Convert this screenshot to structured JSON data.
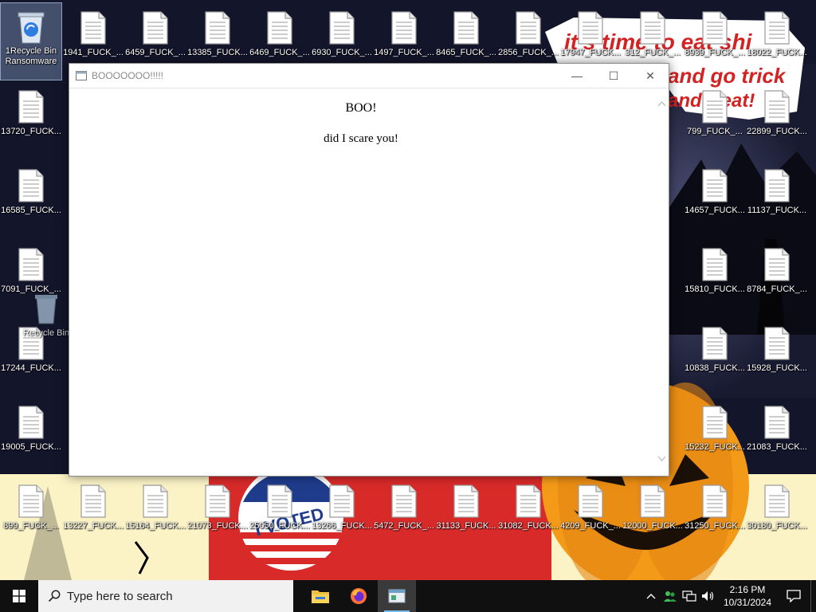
{
  "desktop": {
    "recycle_bin_top": "1Recycle Bin",
    "recycle_bin_sub": "Ransomware",
    "recycle_bin_ghost": "Recycle Bin",
    "files_row1": [
      "1941_FUCK_...",
      "6459_FUCK_...",
      "13385_FUCK...",
      "6469_FUCK_...",
      "6930_FUCK_...",
      "1497_FUCK_...",
      "8465_FUCK_...",
      "2856_FUCK_...",
      "17947_FUCK...",
      "312_FUCK_...",
      "8939_FUCK_...",
      "18022_FUCK..."
    ],
    "files_left": [
      "13720_FUCK...",
      "16585_FUCK...",
      "7091_FUCK_...",
      "17244_FUCK...",
      "19005_FUCK..."
    ],
    "files_right_a": [
      "799_FUCK_...",
      "14657_FUCK...",
      "15810_FUCK...",
      "10838_FUCK...",
      "15232_FUCK..."
    ],
    "files_right_b": [
      "22899_FUCK...",
      "11137_FUCK...",
      "8784_FUCK_...",
      "15928_FUCK...",
      "21083_FUCK..."
    ],
    "files_bottom": [
      "899_FUCK_...",
      "13227_FUCK...",
      "15164_FUCK...",
      "21073_FUCK...",
      "25050_FUCK...",
      "13266_FUCK...",
      "5472_FUCK_...",
      "31133_FUCK...",
      "31082_FUCK...",
      "4209_FUCK_...",
      "12000_FUCK...",
      "31250_FUCK...",
      "30180_FUCK..."
    ]
  },
  "wallpaper": {
    "line1": "it's time to eat shi",
    "line2": "and go trick",
    "line3": "and treat!",
    "badge": "I VOTED",
    "colors": {
      "sky": "#13152b",
      "red": "#d92a2a",
      "pumpkin": "#f39a18",
      "cream": "#fbf3c6"
    }
  },
  "window": {
    "title": "BOOOOOOO!!!!!",
    "heading": "BOO!",
    "message": "did I scare you!",
    "minimize": "—",
    "maximize": "☐",
    "close": "✕"
  },
  "taskbar": {
    "search_placeholder": "Type here to search",
    "apps": [
      "file-explorer",
      "firefox",
      "boo-window"
    ],
    "time": "2:16 PM",
    "date": "10/31/2024"
  }
}
